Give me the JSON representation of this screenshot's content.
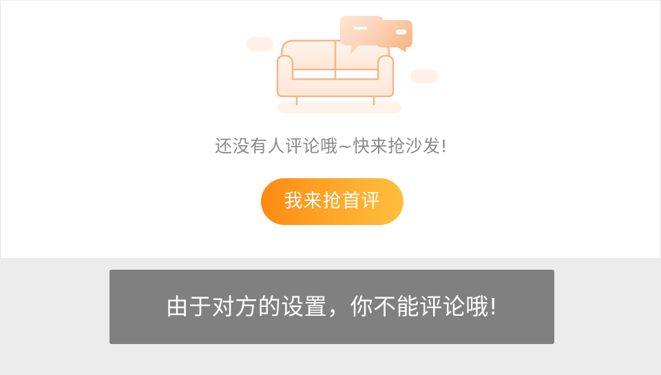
{
  "empty_state": {
    "illustration_icon": "sofa-with-speech-bubbles-icon",
    "message": "还没有人评论哦~快来抢沙发!",
    "button_label": "我来抢首评"
  },
  "toast": {
    "message": "由于对方的设置，你不能评论哦!"
  },
  "colors": {
    "button_gradient_start": "#ff8a12",
    "button_gradient_end": "#ffbe3c",
    "illustration_primary": "#f4b687",
    "message_text": "#8a8a8a",
    "toast_background": "#767676",
    "bottom_background": "#ececec"
  }
}
